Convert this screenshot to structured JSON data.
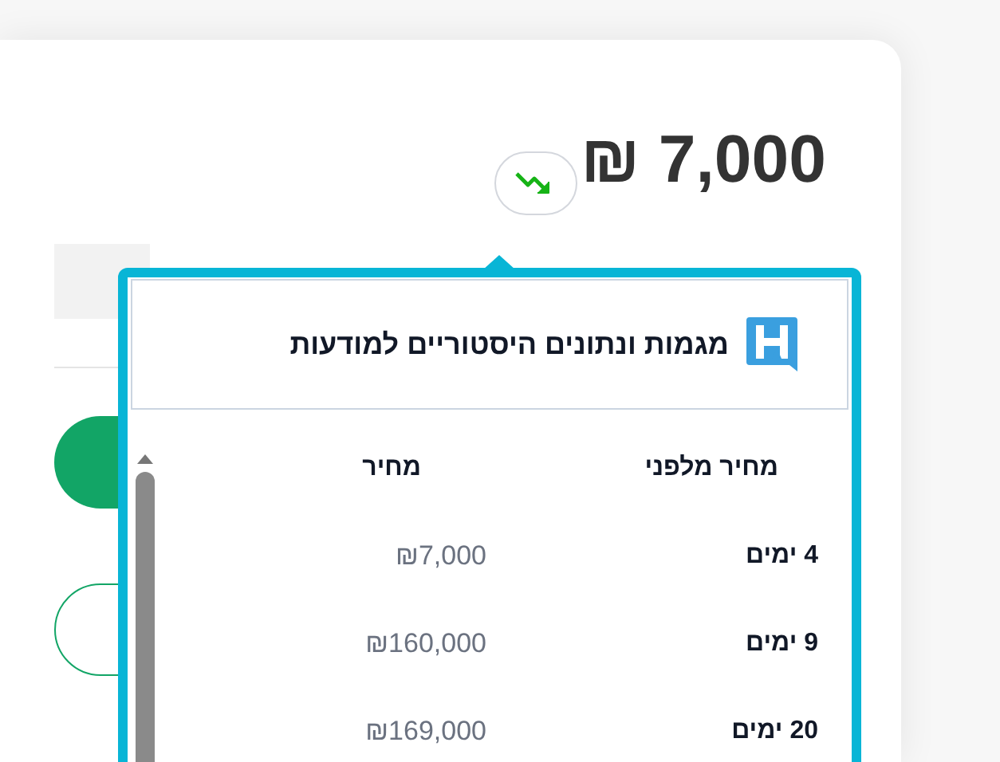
{
  "price": "₪ 7,000",
  "trend_button": {
    "falling": true
  },
  "popover": {
    "title": "מגמות ונתונים היסטוריים למודעות",
    "columns": [
      "מחיר מלפני",
      "מחיר"
    ],
    "rows": [
      {
        "period": "4 ימים",
        "price": "₪7,000"
      },
      {
        "period": "9 ימים",
        "price": "₪160,000"
      },
      {
        "period": "20 ימים",
        "price": "₪169,000"
      }
    ]
  }
}
